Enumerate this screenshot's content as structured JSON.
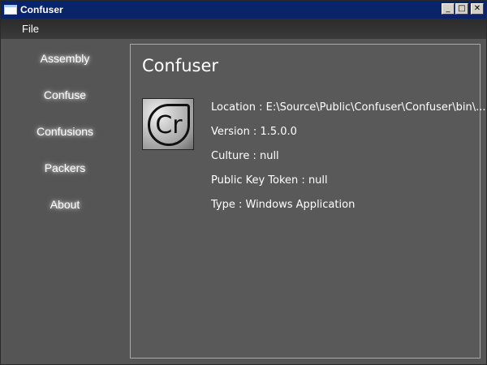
{
  "window": {
    "title": "Confuser"
  },
  "titlebar": {
    "minimize": "_",
    "maximize": "□",
    "close": "✕"
  },
  "menu": {
    "file": "File"
  },
  "sidebar": {
    "items": [
      {
        "label": "Assembly"
      },
      {
        "label": "Confuse"
      },
      {
        "label": "Confusions"
      },
      {
        "label": "Packers"
      },
      {
        "label": "About"
      }
    ]
  },
  "panel": {
    "title": "Confuser",
    "logo_text": "Cr",
    "location": "Location : E:\\Source\\Public\\Confuser\\Confuser\\bin\\...",
    "version": "Version : 1.5.0.0",
    "culture": "Culture : null",
    "public_key_token": "Public Key Token : null",
    "type": "Type : Windows Application"
  },
  "colors": {
    "titlebar": "#0a246a",
    "background": "#555555",
    "text": "#ffffff"
  }
}
